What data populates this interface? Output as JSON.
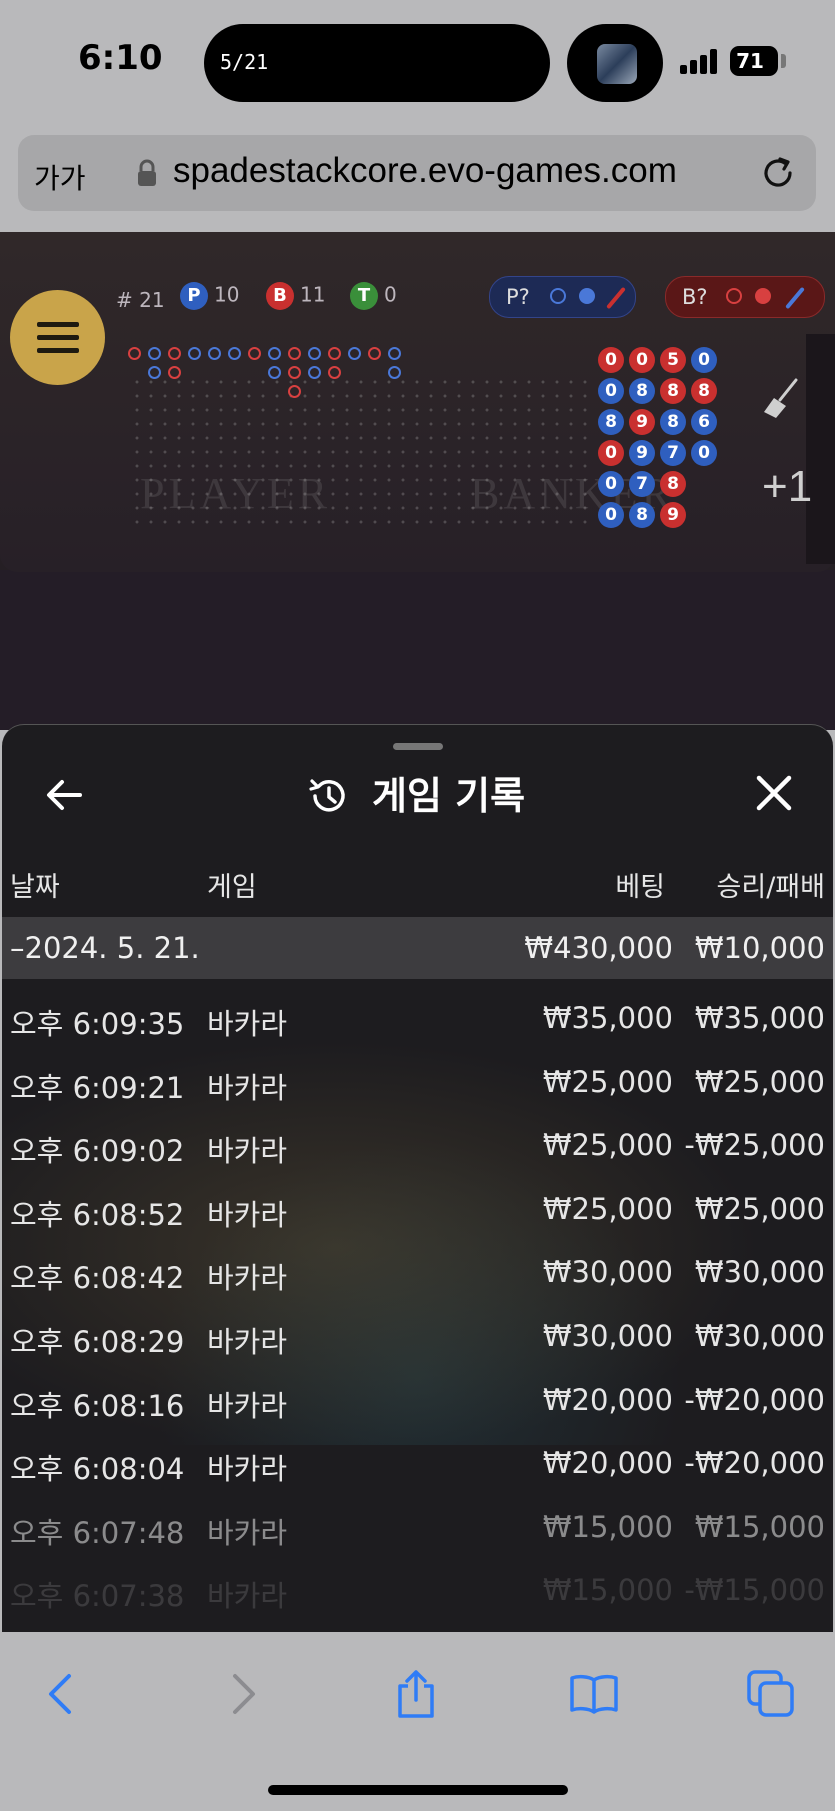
{
  "status_bar": {
    "time": "6:10",
    "island_text": "5/21",
    "battery": "71"
  },
  "browser": {
    "text_size_label": "가가",
    "url": "spadestackcore.evo-games.com"
  },
  "game": {
    "shoe_stats": {
      "round": "# 21",
      "player_badge": "P",
      "player_count": "10",
      "banker_badge": "B",
      "banker_count": "11",
      "tie_badge": "T",
      "tie_count": "0"
    },
    "player_prediction": "P?",
    "banker_prediction": "B?",
    "player_watermark": "PLAYER",
    "banker_watermark": "BANKER",
    "bead_plate": [
      [
        "0",
        "0",
        "5",
        "0"
      ],
      [
        "0",
        "8",
        "8",
        "8"
      ],
      [
        "8",
        "9",
        "8",
        "6"
      ],
      [
        "0",
        "9",
        "7",
        "0"
      ],
      [
        "0",
        "7",
        "8",
        ""
      ],
      [
        "0",
        "8",
        "9",
        ""
      ]
    ],
    "bead_colors": [
      [
        "red",
        "red",
        "red",
        "blue"
      ],
      [
        "blue",
        "blue",
        "red",
        "red"
      ],
      [
        "blue",
        "red",
        "blue",
        "blue"
      ],
      [
        "red",
        "blue",
        "blue",
        "blue"
      ],
      [
        "blue",
        "blue",
        "red",
        ""
      ],
      [
        "blue",
        "blue",
        "red",
        ""
      ]
    ],
    "plus_label": "+1",
    "colors": {
      "player": "#2f5fbf",
      "banker": "#c9302f",
      "tie": "#3a8f3a",
      "gold": "#c9a44a"
    }
  },
  "history": {
    "title": "게임 기록",
    "columns": {
      "date": "날짜",
      "game": "게임",
      "bet": "베팅",
      "win_loss": "승리/패배"
    },
    "summary": {
      "date": "–2024. 5. 21.",
      "bet": "₩430,000",
      "win_loss": "₩10,000"
    },
    "rows": [
      {
        "time": "오후 6:09:35",
        "game": "바카라",
        "bet": "₩35,000",
        "win_loss": "₩35,000"
      },
      {
        "time": "오후 6:09:21",
        "game": "바카라",
        "bet": "₩25,000",
        "win_loss": "₩25,000"
      },
      {
        "time": "오후 6:09:02",
        "game": "바카라",
        "bet": "₩25,000",
        "win_loss": "-₩25,000"
      },
      {
        "time": "오후 6:08:52",
        "game": "바카라",
        "bet": "₩25,000",
        "win_loss": "₩25,000"
      },
      {
        "time": "오후 6:08:42",
        "game": "바카라",
        "bet": "₩30,000",
        "win_loss": "₩30,000"
      },
      {
        "time": "오후 6:08:29",
        "game": "바카라",
        "bet": "₩30,000",
        "win_loss": "₩30,000"
      },
      {
        "time": "오후 6:08:16",
        "game": "바카라",
        "bet": "₩20,000",
        "win_loss": "-₩20,000"
      },
      {
        "time": "오후 6:08:04",
        "game": "바카라",
        "bet": "₩20,000",
        "win_loss": "-₩20,000"
      },
      {
        "time": "오후 6:07:48",
        "game": "바카라",
        "bet": "₩15,000",
        "win_loss": "₩15,000"
      },
      {
        "time": "오후 6:07:38",
        "game": "바카라",
        "bet": "₩15,000",
        "win_loss": "-₩15,000"
      }
    ]
  },
  "toolbar": {
    "icons": [
      "back-icon",
      "forward-icon",
      "share-icon",
      "bookmarks-icon",
      "tabs-icon"
    ]
  }
}
